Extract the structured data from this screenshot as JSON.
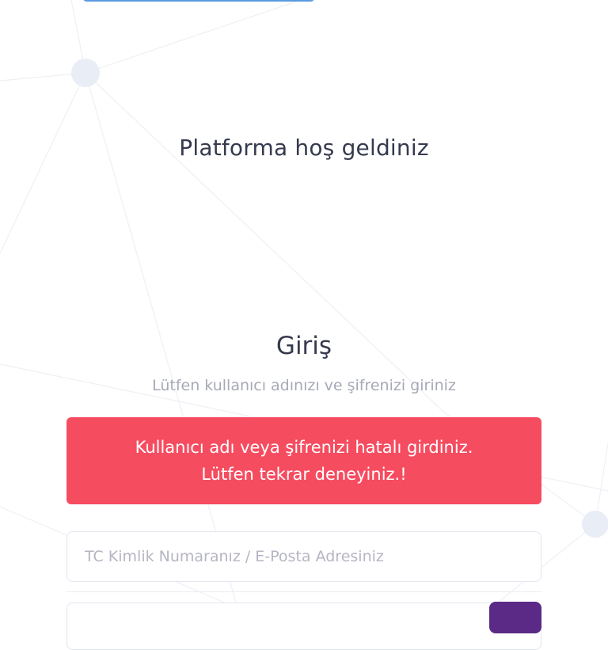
{
  "welcome": {
    "title": "Platforma hoş geldiniz"
  },
  "login": {
    "title": "Giriş",
    "subtitle": "Lütfen kullanıcı adınızı ve şifrenizi giriniz"
  },
  "error": {
    "line1": "Kullanıcı adı veya şifrenizi hatalı girdiniz.",
    "line2": "Lütfen tekrar deneyiniz.!"
  },
  "form": {
    "id_placeholder": "TC Kimlik Numaranız / E-Posta Adresiniz",
    "id_value": ""
  },
  "colors": {
    "accent_blue": "#5a9ae0",
    "error_red": "#f64c60",
    "brand_purple": "#5b2a86",
    "text_dark": "#363a4f",
    "text_muted": "#a6a9b6"
  }
}
